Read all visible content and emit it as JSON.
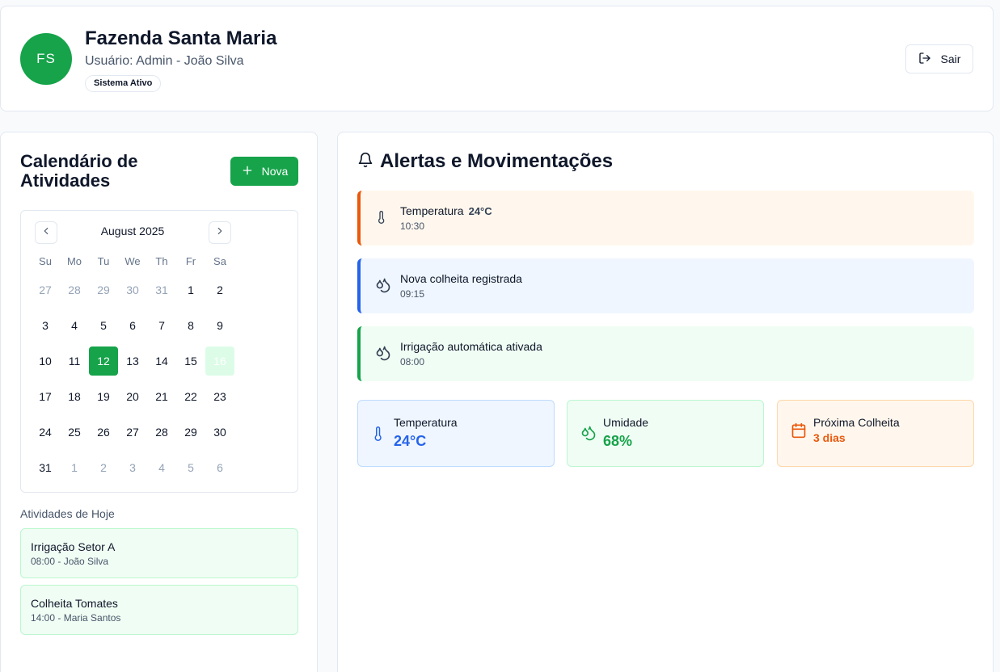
{
  "header": {
    "avatar_initials": "FS",
    "farm_name": "Fazenda Santa Maria",
    "user_line": "Usuário: Admin - João Silva",
    "status_badge": "Sistema Ativo",
    "logout_label": "Sair",
    "logout_icon": "logout-icon"
  },
  "calendar_panel": {
    "title": "Calendário de Atividades",
    "new_button_label": "Nova",
    "month_label": "August 2025",
    "weekdays": [
      "Su",
      "Mo",
      "Tu",
      "We",
      "Th",
      "Fr",
      "Sa"
    ],
    "days": [
      {
        "label": "27",
        "outside": true
      },
      {
        "label": "28",
        "outside": true
      },
      {
        "label": "29",
        "outside": true
      },
      {
        "label": "30",
        "outside": true
      },
      {
        "label": "31",
        "outside": true
      },
      {
        "label": "1"
      },
      {
        "label": "2"
      },
      {
        "label": "3"
      },
      {
        "label": "4"
      },
      {
        "label": "5"
      },
      {
        "label": "6"
      },
      {
        "label": "7"
      },
      {
        "label": "8"
      },
      {
        "label": "9"
      },
      {
        "label": "10"
      },
      {
        "label": "11"
      },
      {
        "label": "12",
        "selected": true
      },
      {
        "label": "13"
      },
      {
        "label": "14"
      },
      {
        "label": "15"
      },
      {
        "label": "16",
        "today": true
      },
      {
        "label": "17"
      },
      {
        "label": "18"
      },
      {
        "label": "19"
      },
      {
        "label": "20"
      },
      {
        "label": "21"
      },
      {
        "label": "22"
      },
      {
        "label": "23"
      },
      {
        "label": "24"
      },
      {
        "label": "25"
      },
      {
        "label": "26"
      },
      {
        "label": "27"
      },
      {
        "label": "28"
      },
      {
        "label": "29"
      },
      {
        "label": "30"
      },
      {
        "label": "31"
      },
      {
        "label": "1",
        "outside": true
      },
      {
        "label": "2",
        "outside": true
      },
      {
        "label": "3",
        "outside": true
      },
      {
        "label": "4",
        "outside": true
      },
      {
        "label": "5",
        "outside": true
      },
      {
        "label": "6",
        "outside": true
      }
    ],
    "today_title": "Atividades de Hoje",
    "activities": [
      {
        "title": "Irrigação Setor A",
        "subtitle": "08:00 - João Silva"
      },
      {
        "title": "Colheita Tomates",
        "subtitle": "14:00 - Maria Santos"
      }
    ]
  },
  "alerts_panel": {
    "title": "Alertas e Movimentações",
    "alerts": [
      {
        "title": "Temperatura",
        "badge": "24°C",
        "time": "10:30",
        "icon": "thermometer-icon"
      },
      {
        "title": "Nova colheita registrada",
        "time": "09:15",
        "icon": "droplets-icon"
      },
      {
        "title": "Irrigação automática ativada",
        "time": "08:00",
        "icon": "droplets-icon"
      }
    ],
    "stats": [
      {
        "label": "Temperatura",
        "value": "24°C",
        "icon": "thermometer-icon"
      },
      {
        "label": "Umidade",
        "value": "68%",
        "icon": "droplets-icon"
      },
      {
        "label": "Próxima Colheita",
        "value": "3 dias",
        "icon": "calendar-icon"
      }
    ]
  },
  "colors": {
    "primary_green": "#16a34a",
    "alert_orange": "#ea580c",
    "alert_blue": "#2563eb"
  }
}
